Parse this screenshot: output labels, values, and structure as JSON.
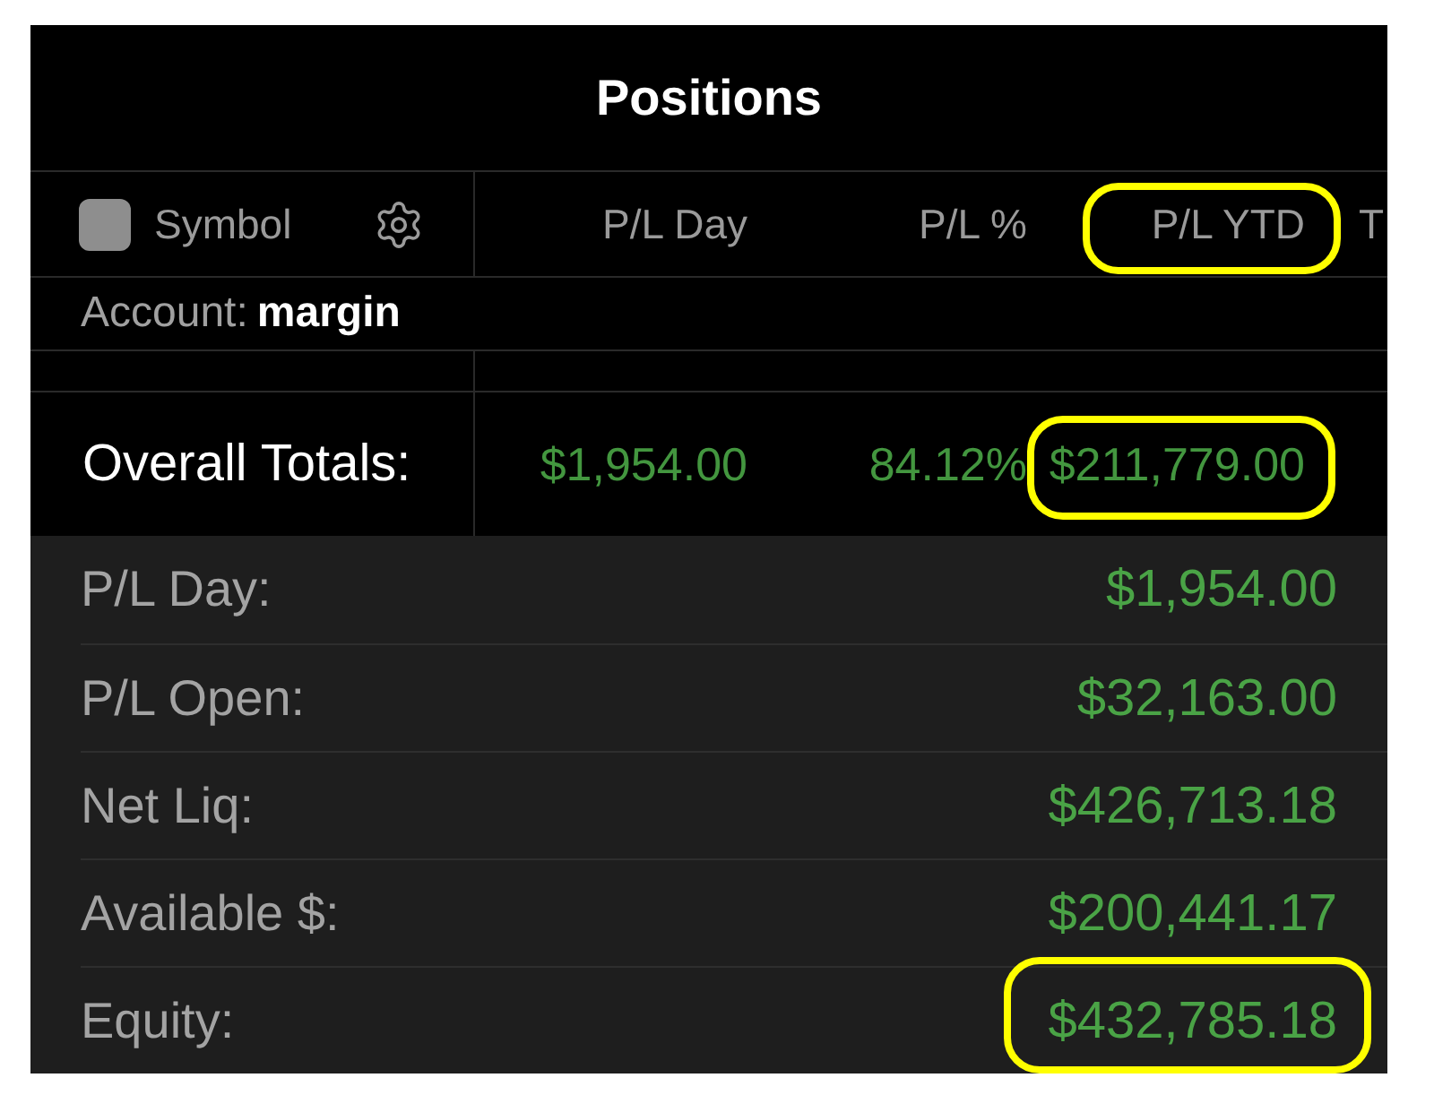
{
  "window": {
    "title": "Positions"
  },
  "header": {
    "checkbox": {
      "checked": false
    },
    "columns": [
      {
        "kind": "symbol",
        "label": "Symbol",
        "highlighted": false
      },
      {
        "kind": "metric",
        "label": "P/L Day",
        "highlighted": false
      },
      {
        "kind": "metric",
        "label": "P/L %",
        "highlighted": false
      },
      {
        "kind": "metric",
        "label": "P/L YTD",
        "highlighted": true
      },
      {
        "kind": "metric",
        "label": "T",
        "highlighted": false
      }
    ]
  },
  "account": {
    "label": "Account:",
    "value": "margin"
  },
  "totals": {
    "label": "Overall Totals:",
    "values": [
      {
        "text": "$1,954.00",
        "highlighted": false
      },
      {
        "text": "84.12%",
        "highlighted": false
      },
      {
        "text": "$211,779.00",
        "highlighted": true
      }
    ]
  },
  "summary": [
    {
      "label": "P/L Day:",
      "value": "$1,954.00",
      "highlighted": false
    },
    {
      "label": "P/L Open:",
      "value": "$32,163.00",
      "highlighted": false
    },
    {
      "label": "Net Liq:",
      "value": "$426,713.18",
      "highlighted": false
    },
    {
      "label": "Available $:",
      "value": "$200,441.17",
      "highlighted": false
    },
    {
      "label": "Equity:",
      "value": "$432,785.18",
      "highlighted": true
    }
  ]
}
